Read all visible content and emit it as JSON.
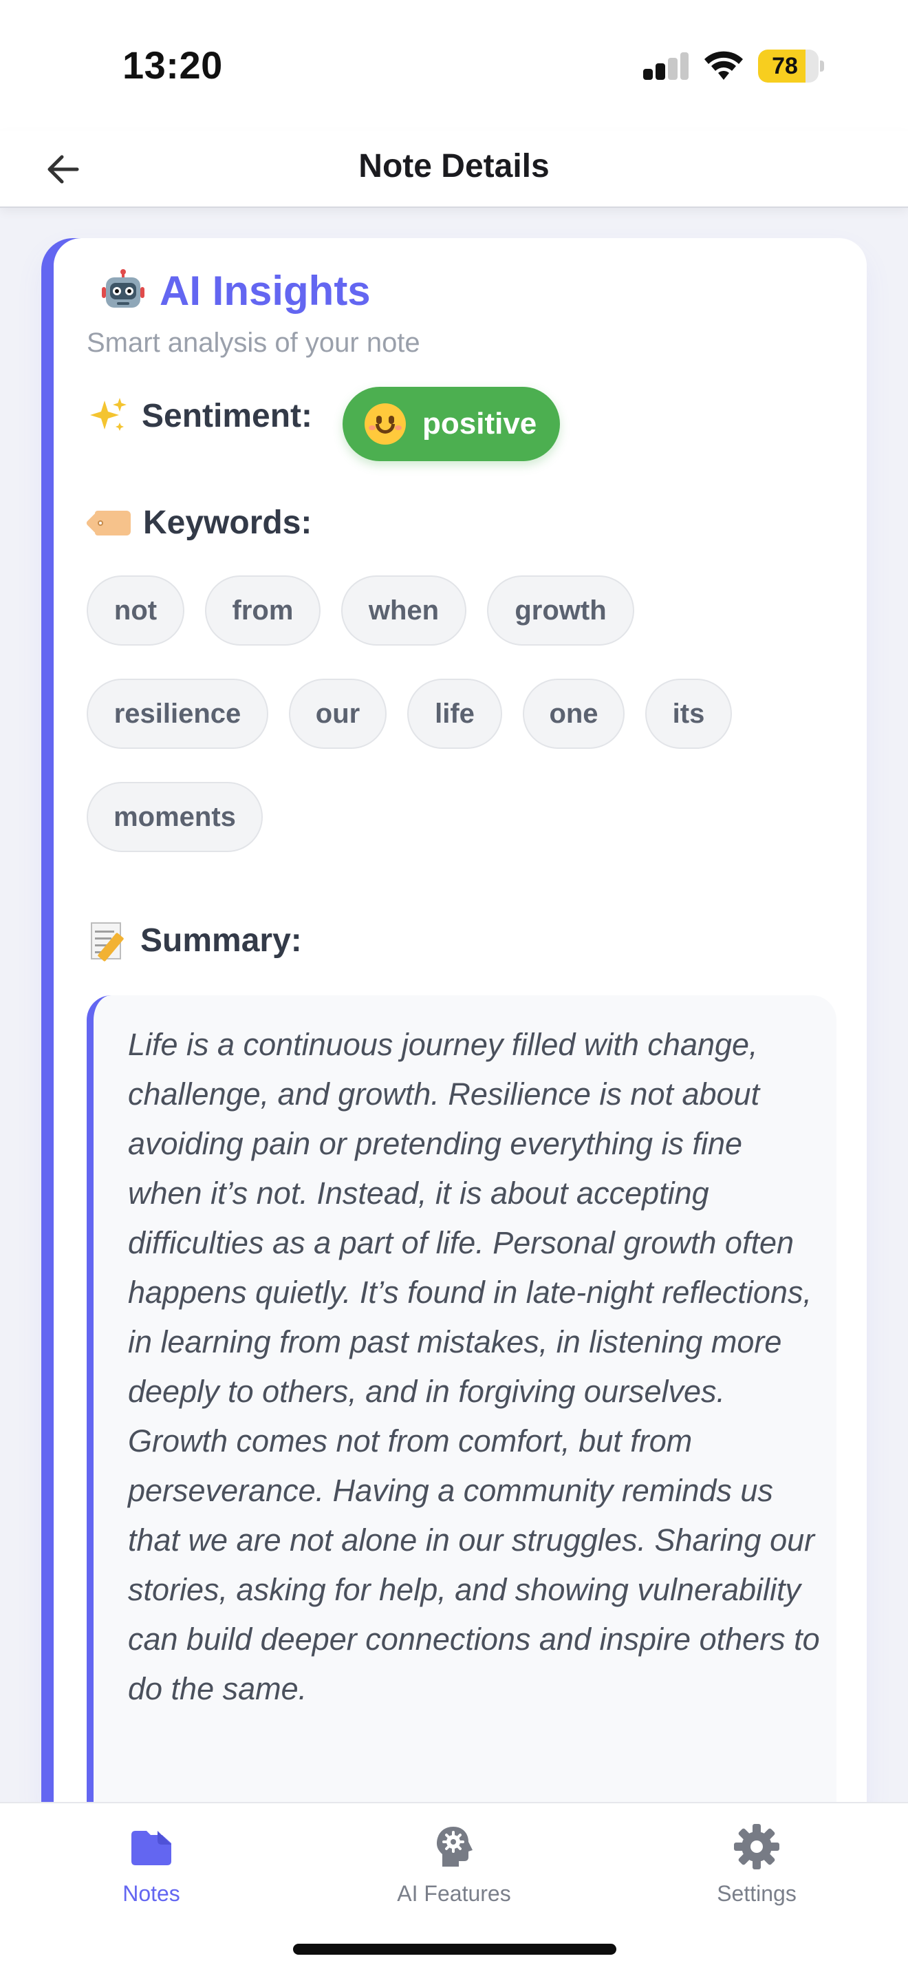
{
  "status_bar": {
    "time": "13:20",
    "battery_percent": "78",
    "battery_level": 0.78,
    "battery_color": "#f7ce1f"
  },
  "header": {
    "title": "Note Details",
    "back_icon": "arrow-left-icon"
  },
  "insights": {
    "icon": "robot-icon",
    "title": "AI Insights",
    "subtitle": "Smart analysis of your note",
    "accent_color": "#6366f1",
    "sentiment": {
      "icon": "sparkles-icon",
      "label": "Sentiment:",
      "value": "positive",
      "value_icon": "smiling-face-icon",
      "color": "#4caf50"
    },
    "keywords": {
      "icon": "tag-icon",
      "label": "Keywords:",
      "items": [
        "not",
        "from",
        "when",
        "growth",
        "resilience",
        "our",
        "life",
        "one",
        "its",
        "moments"
      ]
    },
    "summary": {
      "icon": "memo-icon",
      "label": "Summary:",
      "text": "Life is a continuous journey filled with change, challenge, and growth. Resilience is not about avoiding pain or pretending everything is fine when it’s not. Instead, it is about accepting difficulties as a part of life. Personal growth often happens quietly. It’s found in late-night reflections, in learning from past mistakes, in listening more deeply to others, and in forgiving ourselves. Growth comes not from comfort, but from perseverance. Having a community reminds us that we are not alone in our struggles. Sharing our stories, asking for help, and showing vulnerability can build deeper connections and inspire others to do the same."
    }
  },
  "tab_bar": {
    "tabs": [
      {
        "label": "Notes",
        "icon": "folder-icon",
        "active": true
      },
      {
        "label": "AI Features",
        "icon": "brain-head-icon",
        "active": false
      },
      {
        "label": "Settings",
        "icon": "gear-icon",
        "active": false
      }
    ],
    "active_color": "#6366f1"
  }
}
